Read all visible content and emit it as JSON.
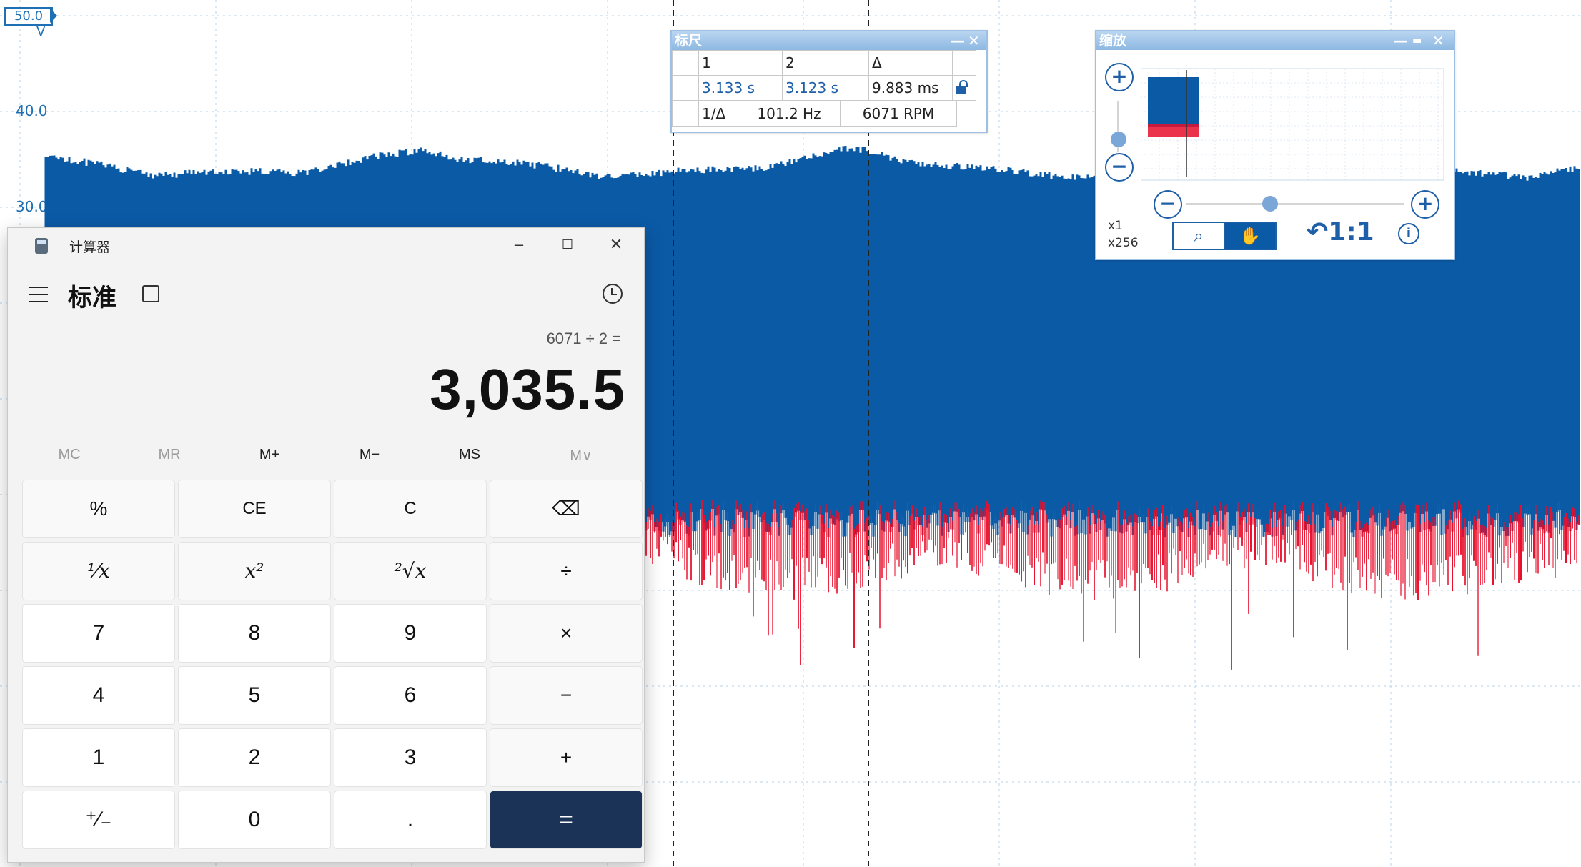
{
  "scope": {
    "range_badge": "50.0",
    "unit": "V",
    "y_ticks": [
      "40.0",
      "30.0"
    ]
  },
  "ruler": {
    "title": "标尺",
    "col1": "1",
    "col2": "2",
    "col_delta": "Δ",
    "t1": "3.133 s",
    "t2": "3.123 s",
    "delta": "9.883 ms",
    "inv_label": "1/Δ",
    "freq": "101.2 Hz",
    "rpm": "6071 RPM"
  },
  "zoom": {
    "title": "缩放",
    "x1_label": "x1",
    "x256_label": "x256",
    "reset_label": "1:1",
    "info": "i"
  },
  "calculator": {
    "window_title": "计算器",
    "mode": "标准",
    "expression": "6071 ÷ 2 =",
    "display": "3,035.5",
    "memory": [
      "MC",
      "MR",
      "M+",
      "M−",
      "MS",
      "M∨"
    ],
    "keys": [
      [
        "%",
        "CE",
        "C",
        "⌫"
      ],
      [
        "¹⁄x",
        "x²",
        "²√x",
        "÷"
      ],
      [
        "7",
        "8",
        "9",
        "×"
      ],
      [
        "4",
        "5",
        "6",
        "−"
      ],
      [
        "1",
        "2",
        "3",
        "+"
      ],
      [
        "⁺⁄₋",
        "0",
        ".",
        "="
      ]
    ]
  },
  "colors": {
    "channel_a": "#0b5aa6",
    "channel_b": "#e8102c",
    "equals_bg": "#1b3356"
  }
}
